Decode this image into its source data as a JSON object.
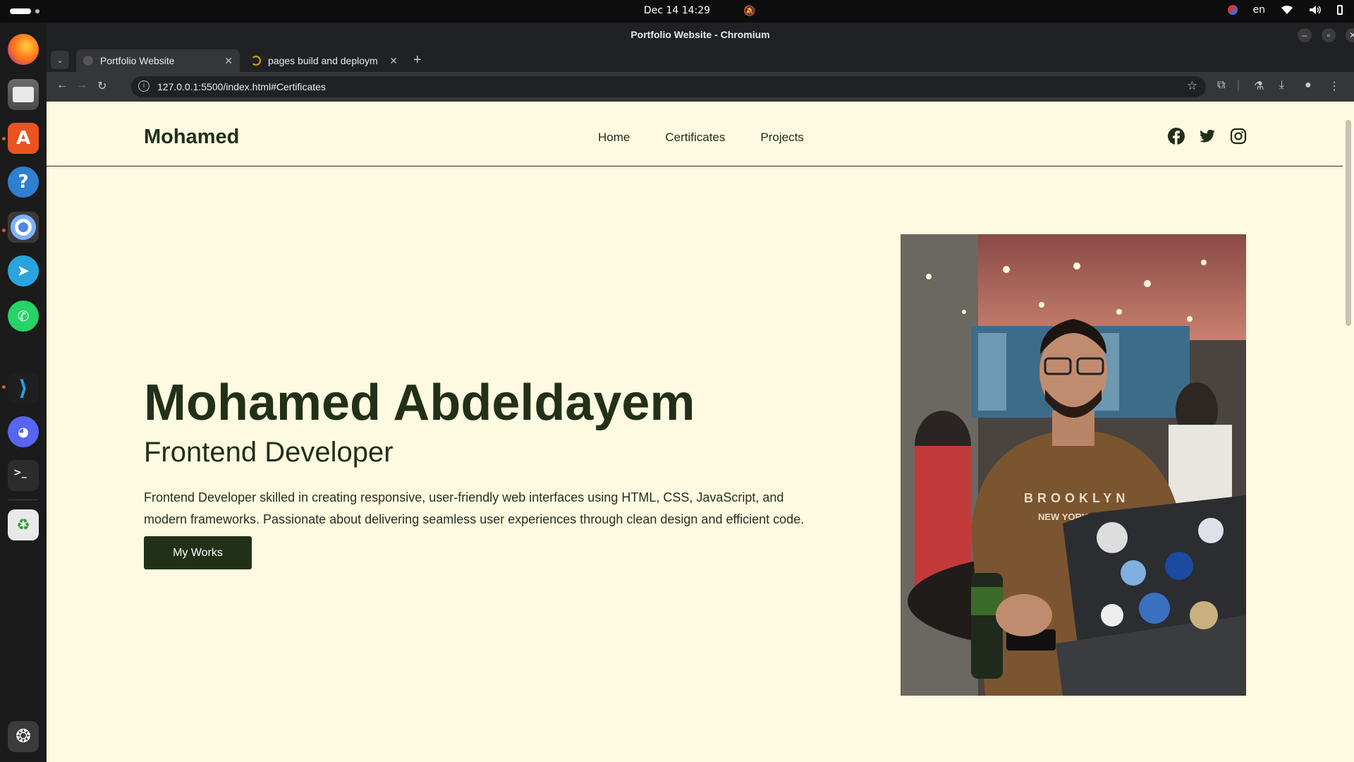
{
  "system": {
    "clock": "Dec 14  14:29",
    "language": "en"
  },
  "dock": {
    "apps": [
      "firefox-icon",
      "files-icon",
      "app-center-icon",
      "help-icon",
      "chromium-icon",
      "telegram-icon",
      "whatsapp-icon",
      "vscode-icon",
      "discord-icon",
      "terminal-icon",
      "trash-icon",
      "show-apps-icon"
    ]
  },
  "browser": {
    "window_title": "Portfolio Website - Chromium",
    "tabs": [
      {
        "label": "Portfolio Website",
        "active": true
      },
      {
        "label": "pages build and deploym",
        "active": false
      }
    ],
    "url": "127.0.0.1:5500/index.html#Certificates"
  },
  "site": {
    "brand": "Mohamed",
    "nav": [
      "Home",
      "Certificates",
      "Projects"
    ],
    "social": [
      "facebook-icon",
      "twitter-icon",
      "instagram-icon"
    ],
    "hero": {
      "name": "Mohamed Abdeldayem",
      "role": "Frontend Developer",
      "description": "Frontend Developer skilled in creating responsive, user-friendly web interfaces using HTML, CSS, JavaScript, and modern frameworks. Passionate about delivering seamless user experiences through clean design and efficient code.",
      "cta": "My Works"
    },
    "colors": {
      "background": "#fef9e1",
      "primary": "#223018"
    }
  }
}
